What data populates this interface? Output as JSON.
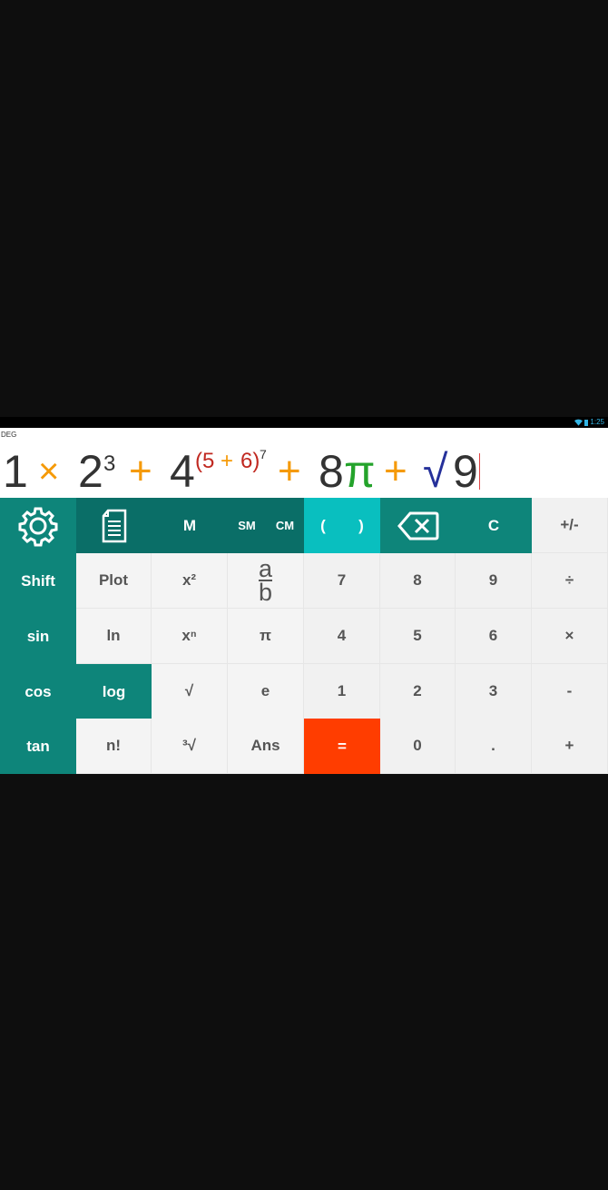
{
  "status": {
    "time": "1:25"
  },
  "display": {
    "mode": "DEG",
    "expression": {
      "t1": "1",
      "times": "×",
      "t2": "2",
      "exp3": "3",
      "plus1": "+",
      "t4": "4",
      "pow_open": "(5",
      "pow_plus": "+",
      "pow_close": "6)",
      "exp7": "7",
      "plus2": "+",
      "t8": "8",
      "pi": "π",
      "plus3": "+",
      "sqrt": "√",
      "t9": "9"
    }
  },
  "keys": {
    "settings": "settings-icon",
    "history": "history-icon",
    "m": "M",
    "sm": "SM",
    "cm": "CM",
    "paren_open": "(",
    "paren_close": ")",
    "backspace": "backspace-icon",
    "clear": "C",
    "plusminus": "+/-",
    "shift": "Shift",
    "plot": "Plot",
    "x2": "x²",
    "frac_a": "a",
    "frac_b": "b",
    "seven": "7",
    "eight": "8",
    "nine": "9",
    "divide": "÷",
    "sin": "sin",
    "ln": "ln",
    "xn": "xⁿ",
    "pi": "π",
    "four": "4",
    "five": "5",
    "six": "6",
    "multiply": "×",
    "cos": "cos",
    "log": "log",
    "sqrt": "√",
    "e": "e",
    "one": "1",
    "two": "2",
    "three": "3",
    "minus": "-",
    "tan": "tan",
    "fact": "n!",
    "cbrt": "³√",
    "ans": "Ans",
    "equals": "=",
    "zero": "0",
    "dot": ".",
    "plus": "+"
  },
  "colors": {
    "teal": "#0e857a",
    "dark_teal": "#0a6e67",
    "cyan": "#09bfbf",
    "equals_orange": "#ff3d00",
    "operator_orange": "#f59a08",
    "pi_green": "#24a32b",
    "sqrt_navy": "#25309a"
  }
}
